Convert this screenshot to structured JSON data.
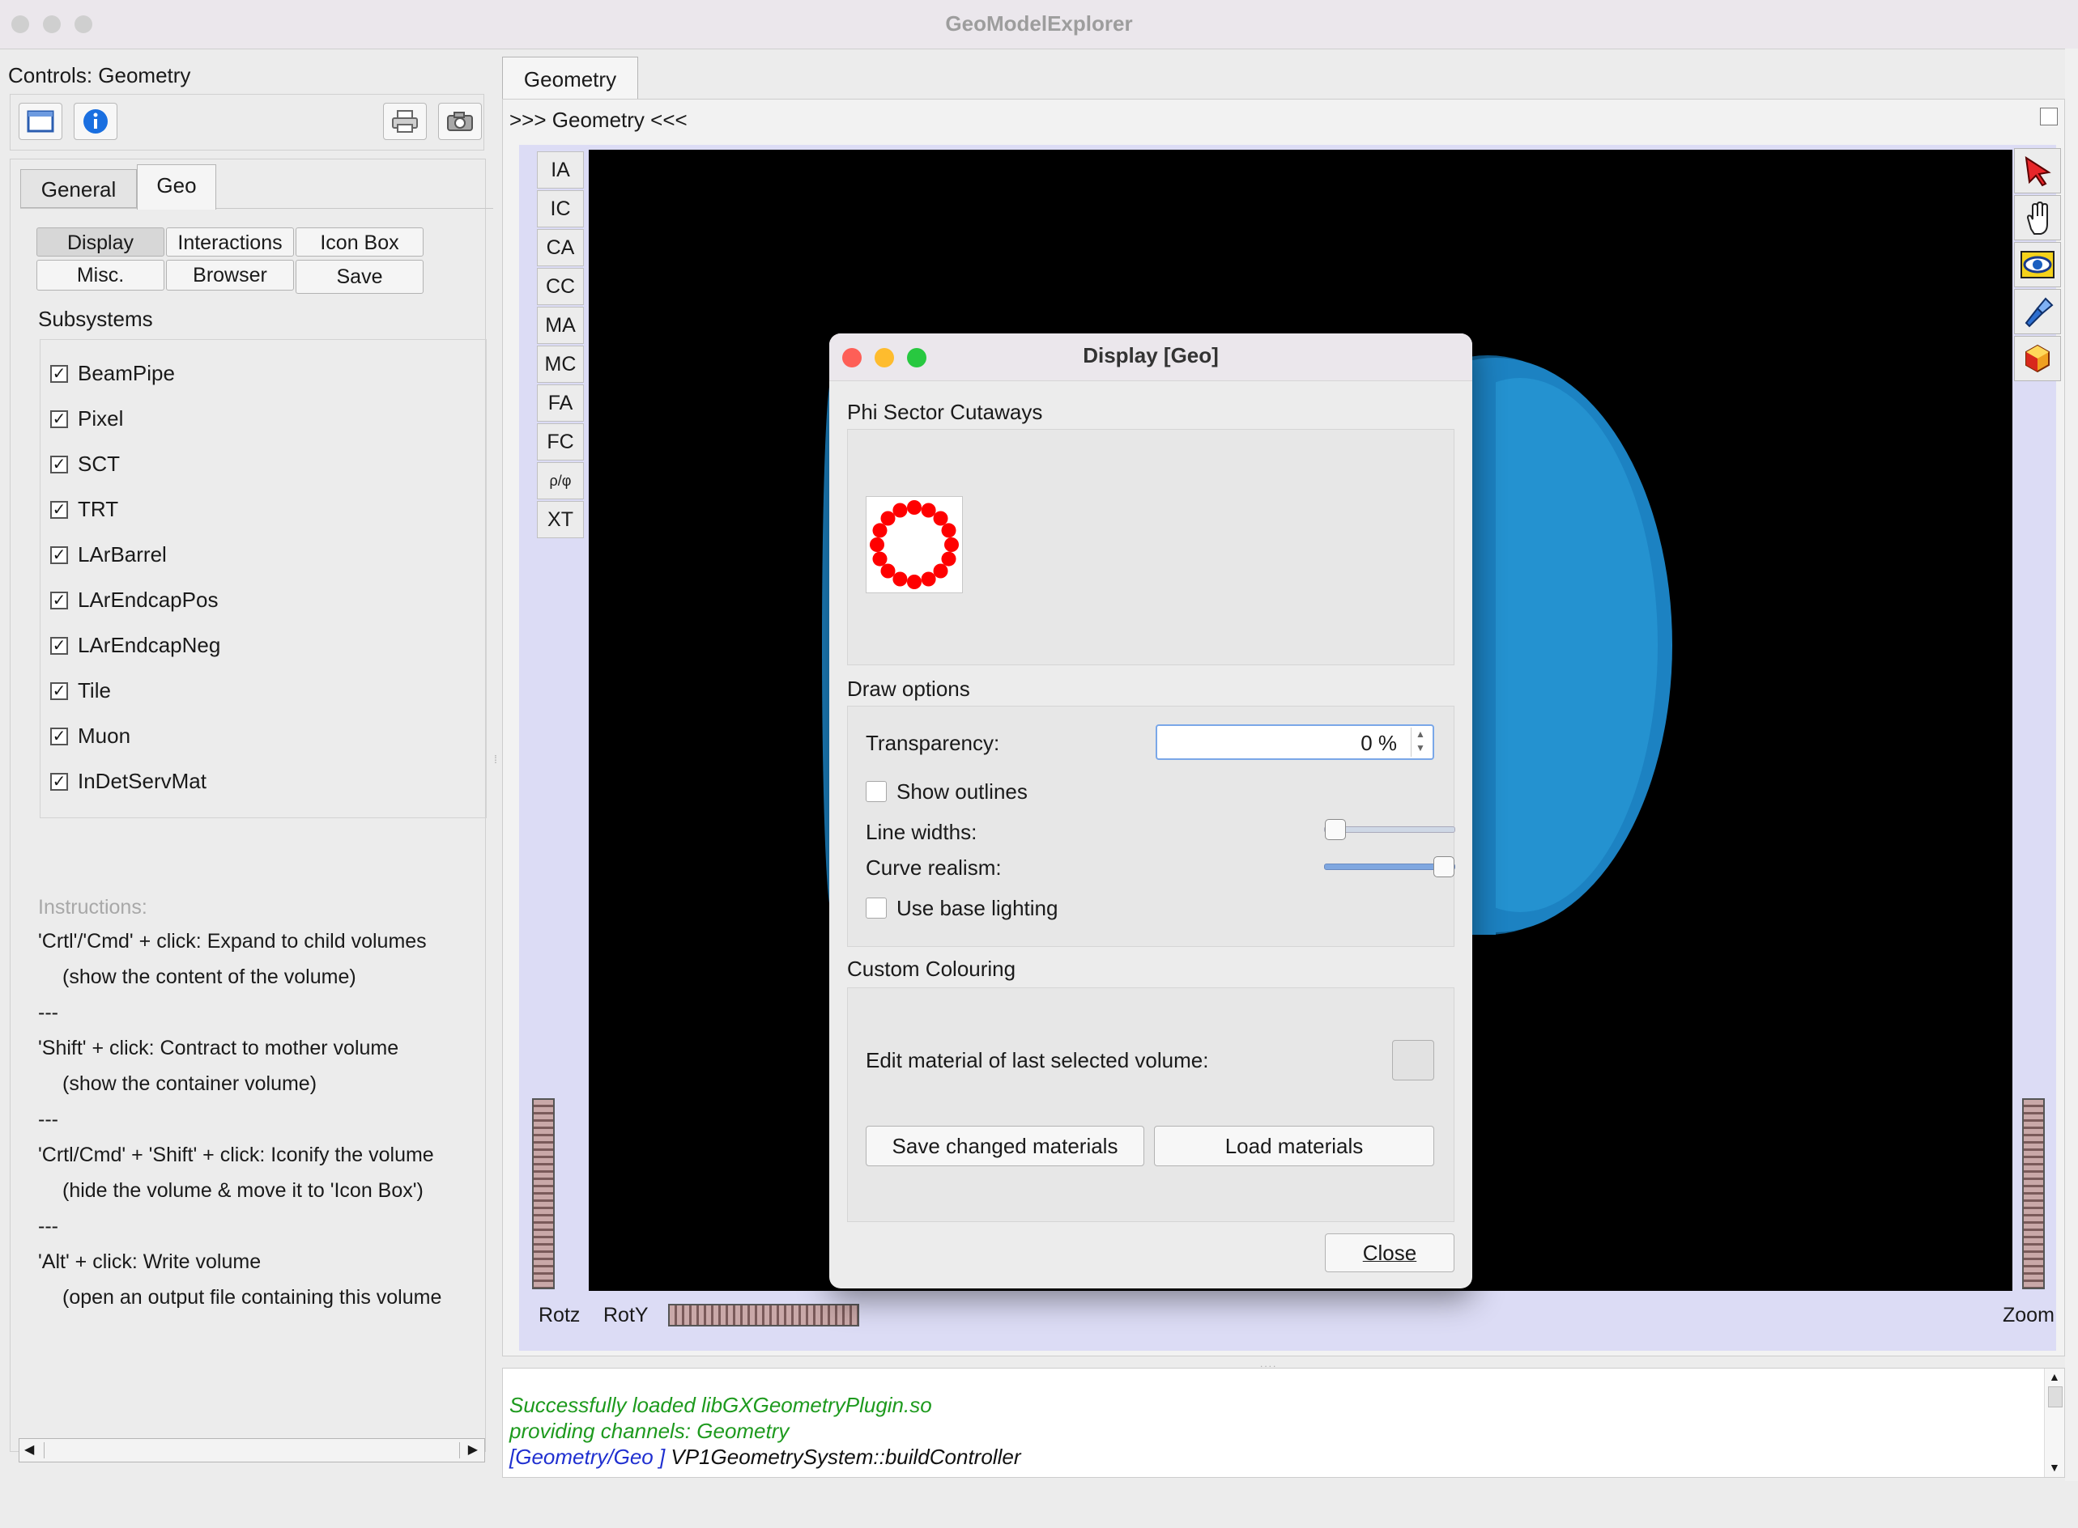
{
  "window": {
    "title": "GeoModelExplorer"
  },
  "controls": {
    "title": "Controls: Geometry",
    "tabs": [
      "General",
      "Geo"
    ],
    "buttons": [
      "Display",
      "Interactions",
      "Icon Box",
      "Misc.",
      "Browser",
      "Save"
    ],
    "subsystems_title": "Subsystems",
    "subsystems": [
      "BeamPipe",
      "Pixel",
      "SCT",
      "TRT",
      "LArBarrel",
      "LArEndcapPos",
      "LArEndcapNeg",
      "Tile",
      "Muon",
      "InDetServMat"
    ],
    "checked_mark": "✓",
    "instructions_title": "Instructions:",
    "instructions": [
      "'Crtl'/'Cmd' + click: Expand to child volumes",
      "(show the content of the volume)",
      "---",
      "'Shift' + click: Contract to mother volume",
      "(show the container volume)",
      "---",
      "'Crtl/Cmd' + 'Shift' + click: Iconify the volume",
      "(hide the volume & move it to 'Icon Box')",
      "---",
      "'Alt' + click: Write volume",
      "(open an output file containing this volume"
    ]
  },
  "viewer": {
    "tab": "Geometry",
    "header": ">>> Geometry <<<",
    "side_buttons": [
      "IA",
      "IC",
      "CA",
      "CC",
      "MA",
      "MC",
      "FA",
      "FC",
      "ρ/φ",
      "XT"
    ],
    "right_icons": [
      "select-arrow-icon",
      "pan-hand-icon",
      "view-eye-icon",
      "flashlight-icon",
      "cube-icon"
    ],
    "rotz": "Rotz",
    "roty": "RotY",
    "zoom": "Zoom",
    "background": "#000000",
    "object_color": "#1c82c2"
  },
  "dialog": {
    "title": "Display [Geo]",
    "phi_title": "Phi Sector Cutaways",
    "draw_title": "Draw options",
    "transparency_label": "Transparency:",
    "transparency_value": "0 %",
    "show_outlines": "Show outlines",
    "show_outlines_checked": false,
    "line_widths": "Line widths:",
    "line_widths_level": 0.0,
    "curve_realism": "Curve realism:",
    "curve_realism_level": 1.0,
    "use_base_lighting": "Use base lighting",
    "use_base_lighting_checked": false,
    "custom_title": "Custom Colouring",
    "edit_material": "Edit material of last selected volume:",
    "save_materials": "Save changed materials",
    "load_materials": "Load materials",
    "close": "Close",
    "phi_sector_color": "#ff0000"
  },
  "log": {
    "line1": "Successfully loaded libGXGeometryPlugin.so",
    "line2": "providing channels: Geometry",
    "line3_tag": "[Geometry/Geo ]",
    "line3_text": " VP1GeometrySystem::buildController",
    "green": "#1e9a1e",
    "blue": "#1f2fd0"
  }
}
